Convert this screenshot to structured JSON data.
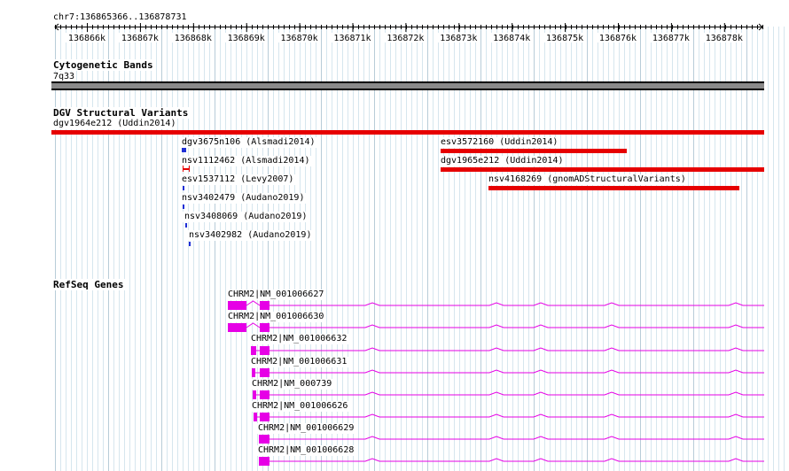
{
  "ruler": {
    "location": "chr7:136865366..136878731",
    "ticks": [
      "136866k",
      "136867k",
      "136868k",
      "136869k",
      "136870k",
      "136871k",
      "136872k",
      "136873k",
      "136874k",
      "136875k",
      "136876k",
      "136877k",
      "136878k"
    ]
  },
  "cytoband": {
    "title": "Cytogenetic Bands",
    "band_name": "7q33"
  },
  "dgv": {
    "title": "DGV Structural Variants",
    "items": [
      {
        "label": "dgv1964e212 (Uddin2014)",
        "color": "#e60000"
      },
      {
        "label": "dgv3675n106 (Alsmadi2014)",
        "color": "#1f2fd6"
      },
      {
        "label": "nsv1112462 (Alsmadi2014)",
        "color": "#e60000"
      },
      {
        "label": "esv1537112 (Levy2007)",
        "color": "#1f2fd6"
      },
      {
        "label": "nsv3402479 (Audano2019)",
        "color": "#1f2fd6"
      },
      {
        "label": "nsv3408069 (Audano2019)",
        "color": "#1f2fd6"
      },
      {
        "label": "nsv3402982 (Audano2019)",
        "color": "#1f2fd6"
      },
      {
        "label": "esv3572160 (Uddin2014)",
        "color": "#e60000"
      },
      {
        "label": "dgv1965e212 (Uddin2014)",
        "color": "#e60000"
      },
      {
        "label": "nsv4168269 (gnomADStructuralVariants)",
        "color": "#e60000"
      }
    ]
  },
  "refseq": {
    "title": "RefSeq Genes",
    "color": "#e600e6",
    "genes": [
      {
        "label": "CHRM2|NM_001006627"
      },
      {
        "label": "CHRM2|NM_001006630"
      },
      {
        "label": "CHRM2|NM_001006632"
      },
      {
        "label": "CHRM2|NM_001006631"
      },
      {
        "label": "CHRM2|NM_000739"
      },
      {
        "label": "CHRM2|NM_001006626"
      },
      {
        "label": "CHRM2|NM_001006629"
      },
      {
        "label": "CHRM2|NM_001006628"
      }
    ]
  }
}
